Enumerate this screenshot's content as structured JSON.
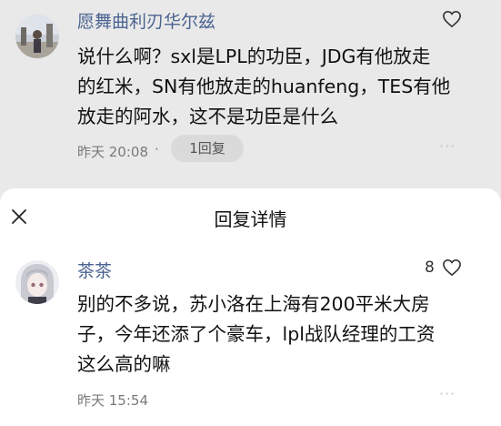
{
  "comment": {
    "username": "愿舞曲利刃华尔兹",
    "lines": [
      "说什么啊？sxl是LPL的功臣，JDG有他放走",
      "的红米，SN有他放走的huanfeng，TES有他",
      "放走的阿水，这不是功臣是什么"
    ],
    "timestamp": "昨天 20:08",
    "separator": "·",
    "reply_count_label": "1回复",
    "more": "···",
    "icons": {
      "like": "heart-outline-icon",
      "avatar": "user-avatar-photo"
    }
  },
  "reply_panel": {
    "title": "回复详情",
    "close_icon": "close-icon",
    "reply": {
      "username": "茶茶",
      "likes": "8",
      "lines": [
        "别的不多说，苏小洛在上海有200平米大房",
        "子，今年还添了个豪车，lpl战队经理的工资",
        "这么高的嘛"
      ],
      "timestamp": "昨天 15:54",
      "more": "···"
    }
  },
  "colors": {
    "username": "#4a6391",
    "top_bg": "#e9e9e9",
    "sheet_bg": "#ffffff"
  }
}
